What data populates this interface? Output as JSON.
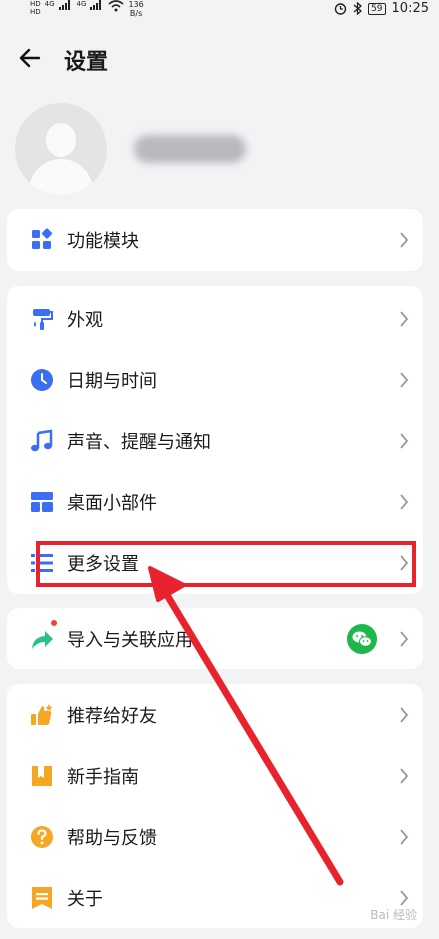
{
  "status_bar": {
    "signal_labels": [
      "HD",
      "HD",
      "4G",
      "4G"
    ],
    "net_speed_value": "136",
    "net_speed_unit": "B/s",
    "battery": "59",
    "time": "10:25"
  },
  "header": {
    "title": "设置"
  },
  "cards": [
    {
      "items": [
        {
          "label": "功能模块",
          "icon": "grid-icon"
        }
      ]
    },
    {
      "items": [
        {
          "label": "外观",
          "icon": "paint-roller-icon"
        },
        {
          "label": "日期与时间",
          "icon": "clock-icon"
        },
        {
          "label": "声音、提醒与通知",
          "icon": "music-note-icon"
        },
        {
          "label": "桌面小部件",
          "icon": "widget-icon"
        },
        {
          "label": "更多设置",
          "icon": "list-icon"
        }
      ]
    },
    {
      "items": [
        {
          "label": "导入与关联应用",
          "icon": "share-arrow-icon"
        }
      ]
    },
    {
      "items": [
        {
          "label": "推荐给好友",
          "icon": "thumbs-up-icon"
        },
        {
          "label": "新手指南",
          "icon": "book-icon"
        },
        {
          "label": "帮助与反馈",
          "icon": "help-icon"
        },
        {
          "label": "关于",
          "icon": "info-flag-icon"
        }
      ]
    }
  ],
  "colors": {
    "accent": "#3b6ef5",
    "highlight": "#e8232e",
    "wechat": "#1fb64c"
  },
  "watermark": "Bai 经验"
}
